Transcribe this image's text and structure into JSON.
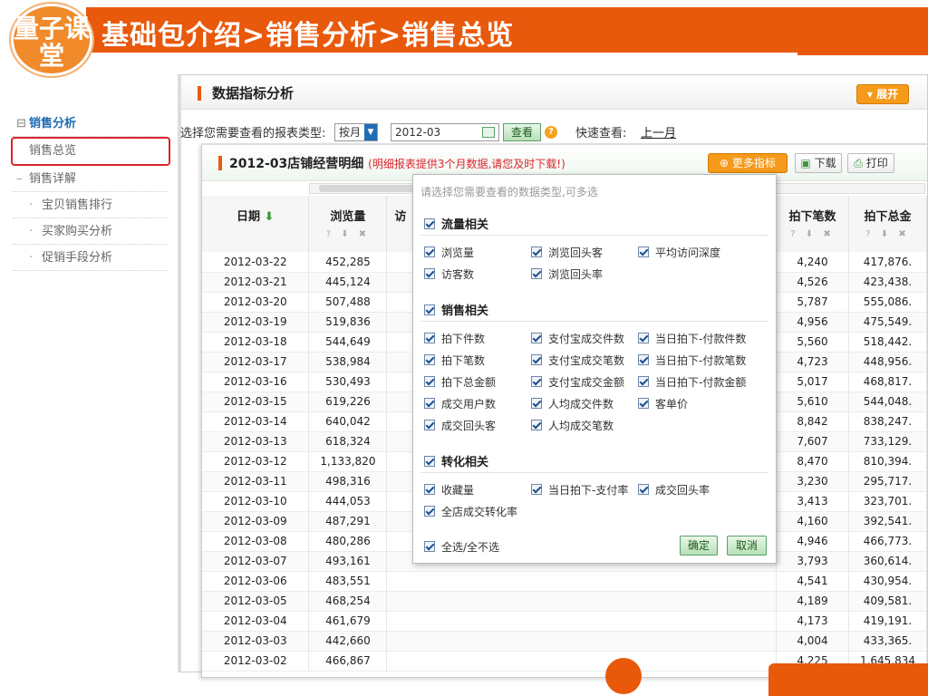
{
  "banner": {
    "title": "基础包介绍>销售分析>销售总览",
    "logo_text": "量子课堂"
  },
  "sidebar": {
    "items": [
      {
        "label": "销售分析",
        "icon": "⊟"
      },
      {
        "label": "销售总览"
      },
      {
        "label": "销售详解",
        "icon": "–"
      },
      {
        "label": "宝贝销售排行",
        "icon": "·"
      },
      {
        "label": "买家购买分析",
        "icon": "·"
      },
      {
        "label": "促销手段分析",
        "icon": "·"
      }
    ]
  },
  "panel": {
    "title": "数据指标分析",
    "expand_label": "▾ 展开",
    "report_type_label": "选择您需要查看的报表类型:",
    "period_select": "按月",
    "month_value": "2012-03",
    "query_label": "查看",
    "quick_label": "快速查看:",
    "quick_link": "上一月"
  },
  "detail": {
    "title": "2012-03店铺经营明细",
    "note": "(明细报表提供3个月数据,请您及时下载!)",
    "more_label": "更多指标",
    "download_label": "下载",
    "print_label": "打印",
    "columns": [
      "日期",
      "浏览量",
      "访",
      "拍下笔数",
      "拍下总金"
    ],
    "rows": [
      {
        "date": "2012-03-22",
        "pv": "452,285",
        "orders": "4,240",
        "amount": "417,876."
      },
      {
        "date": "2012-03-21",
        "pv": "445,124",
        "orders": "4,526",
        "amount": "423,438."
      },
      {
        "date": "2012-03-20",
        "pv": "507,488",
        "orders": "5,787",
        "amount": "555,086."
      },
      {
        "date": "2012-03-19",
        "pv": "519,836",
        "orders": "4,956",
        "amount": "475,549."
      },
      {
        "date": "2012-03-18",
        "pv": "544,649",
        "orders": "5,560",
        "amount": "518,442."
      },
      {
        "date": "2012-03-17",
        "pv": "538,984",
        "orders": "4,723",
        "amount": "448,956."
      },
      {
        "date": "2012-03-16",
        "pv": "530,493",
        "orders": "5,017",
        "amount": "468,817."
      },
      {
        "date": "2012-03-15",
        "pv": "619,226",
        "orders": "5,610",
        "amount": "544,048."
      },
      {
        "date": "2012-03-14",
        "pv": "640,042",
        "orders": "8,842",
        "amount": "838,247."
      },
      {
        "date": "2012-03-13",
        "pv": "618,324",
        "orders": "7,607",
        "amount": "733,129."
      },
      {
        "date": "2012-03-12",
        "pv": "1,133,820",
        "orders": "8,470",
        "amount": "810,394."
      },
      {
        "date": "2012-03-11",
        "pv": "498,316",
        "orders": "3,230",
        "amount": "295,717."
      },
      {
        "date": "2012-03-10",
        "pv": "444,053",
        "orders": "3,413",
        "amount": "323,701."
      },
      {
        "date": "2012-03-09",
        "pv": "487,291",
        "orders": "4,160",
        "amount": "392,541."
      },
      {
        "date": "2012-03-08",
        "pv": "480,286",
        "orders": "4,946",
        "amount": "466,773."
      },
      {
        "date": "2012-03-07",
        "pv": "493,161",
        "orders": "3,793",
        "amount": "360,614."
      },
      {
        "date": "2012-03-06",
        "pv": "483,551",
        "orders": "4,541",
        "amount": "430,954."
      },
      {
        "date": "2012-03-05",
        "pv": "468,254",
        "orders": "4,189",
        "amount": "409,581."
      },
      {
        "date": "2012-03-04",
        "pv": "461,679",
        "orders": "4,173",
        "amount": "419,191."
      },
      {
        "date": "2012-03-03",
        "pv": "442,660",
        "orders": "4,004",
        "amount": "433,365."
      },
      {
        "date": "2012-03-02",
        "pv": "466,867",
        "orders": "4,225",
        "amount": "1,645,834"
      }
    ]
  },
  "popup": {
    "hint": "请选择您需要查看的数据类型,可多选",
    "groups": [
      {
        "title": "流量相关",
        "options": [
          "浏览量",
          "浏览回头客",
          "平均访问深度",
          "访客数",
          "浏览回头率"
        ]
      },
      {
        "title": "销售相关",
        "options": [
          "拍下件数",
          "支付宝成交件数",
          "当日拍下-付款件数",
          "拍下笔数",
          "支付宝成交笔数",
          "当日拍下-付款笔数",
          "拍下总金额",
          "支付宝成交金额",
          "当日拍下-付款金额",
          "成交用户数",
          "人均成交件数",
          "客单价",
          "成交回头客",
          "人均成交笔数"
        ]
      },
      {
        "title": "转化相关",
        "options": [
          "收藏量",
          "当日拍下-支付率",
          "成交回头率",
          "全店成交转化率"
        ]
      }
    ],
    "select_all": "全选/全不选",
    "ok": "确定",
    "cancel": "取消"
  }
}
